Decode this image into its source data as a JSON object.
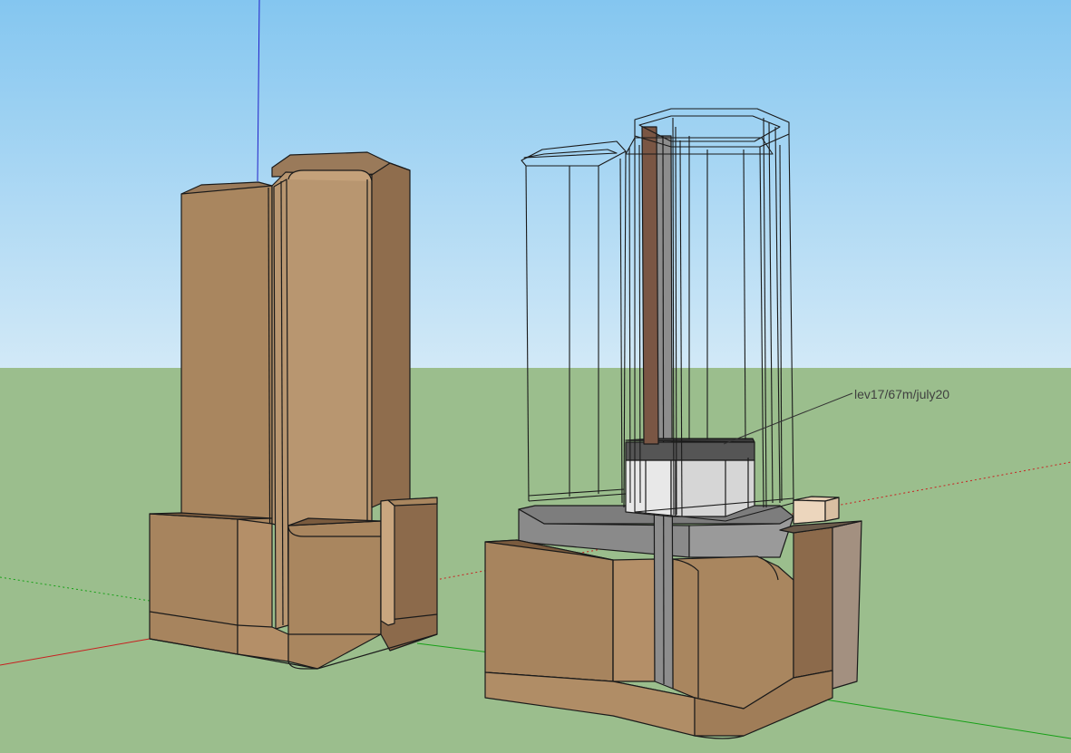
{
  "viewport": {
    "sky_top": "#84c6f0",
    "sky_bottom": "#d2e9f7",
    "ground": "#9bbe8d",
    "axis_red": "#c82020",
    "axis_green": "#16a016",
    "axis_blue": "#2020c8"
  },
  "materials": {
    "stone_light": "#b8956f",
    "stone_mid": "#a98863",
    "stone_dark": "#8c6a4b",
    "stone_shadow": "#7a5b3e",
    "podium_gray": "#8a8a8a",
    "podium_gray_dark": "#6e6e6e",
    "core_brown": "#7a5644",
    "white_block": "#e2e2e2"
  },
  "annotation": {
    "text": "lev17/67m/july20"
  }
}
